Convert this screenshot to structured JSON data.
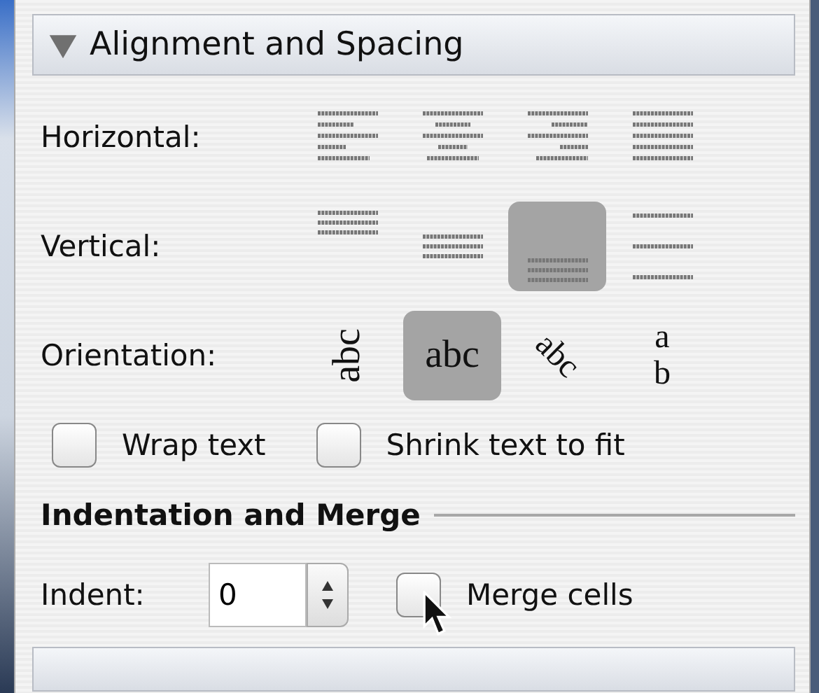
{
  "header": {
    "title": "Alignment and Spacing",
    "expanded": true
  },
  "horizontal": {
    "label": "Horizontal:",
    "options": [
      {
        "kind": "left",
        "selected": false
      },
      {
        "kind": "center",
        "selected": false
      },
      {
        "kind": "right",
        "selected": false
      },
      {
        "kind": "justify",
        "selected": false
      }
    ]
  },
  "vertical": {
    "label": "Vertical:",
    "options": [
      {
        "kind": "top",
        "selected": false
      },
      {
        "kind": "middle",
        "selected": false
      },
      {
        "kind": "bottom",
        "selected": true
      },
      {
        "kind": "spread",
        "selected": false
      }
    ]
  },
  "orientation": {
    "label": "Orientation:",
    "options": [
      {
        "kind": "rotated",
        "text": "abc",
        "selected": false
      },
      {
        "kind": "normal",
        "text": "abc",
        "selected": true
      },
      {
        "kind": "angled",
        "text": "abc",
        "selected": false
      },
      {
        "kind": "stacked",
        "text": "ab",
        "selected": false
      }
    ]
  },
  "checkboxes": [
    {
      "label": "Wrap text",
      "checked": false
    },
    {
      "label": "Shrink text to fit",
      "checked": false
    }
  ],
  "section": {
    "title": "Indentation and Merge"
  },
  "indent": {
    "label": "Indent:",
    "value": "0"
  },
  "merge": {
    "label": "Merge cells",
    "checked": false
  }
}
